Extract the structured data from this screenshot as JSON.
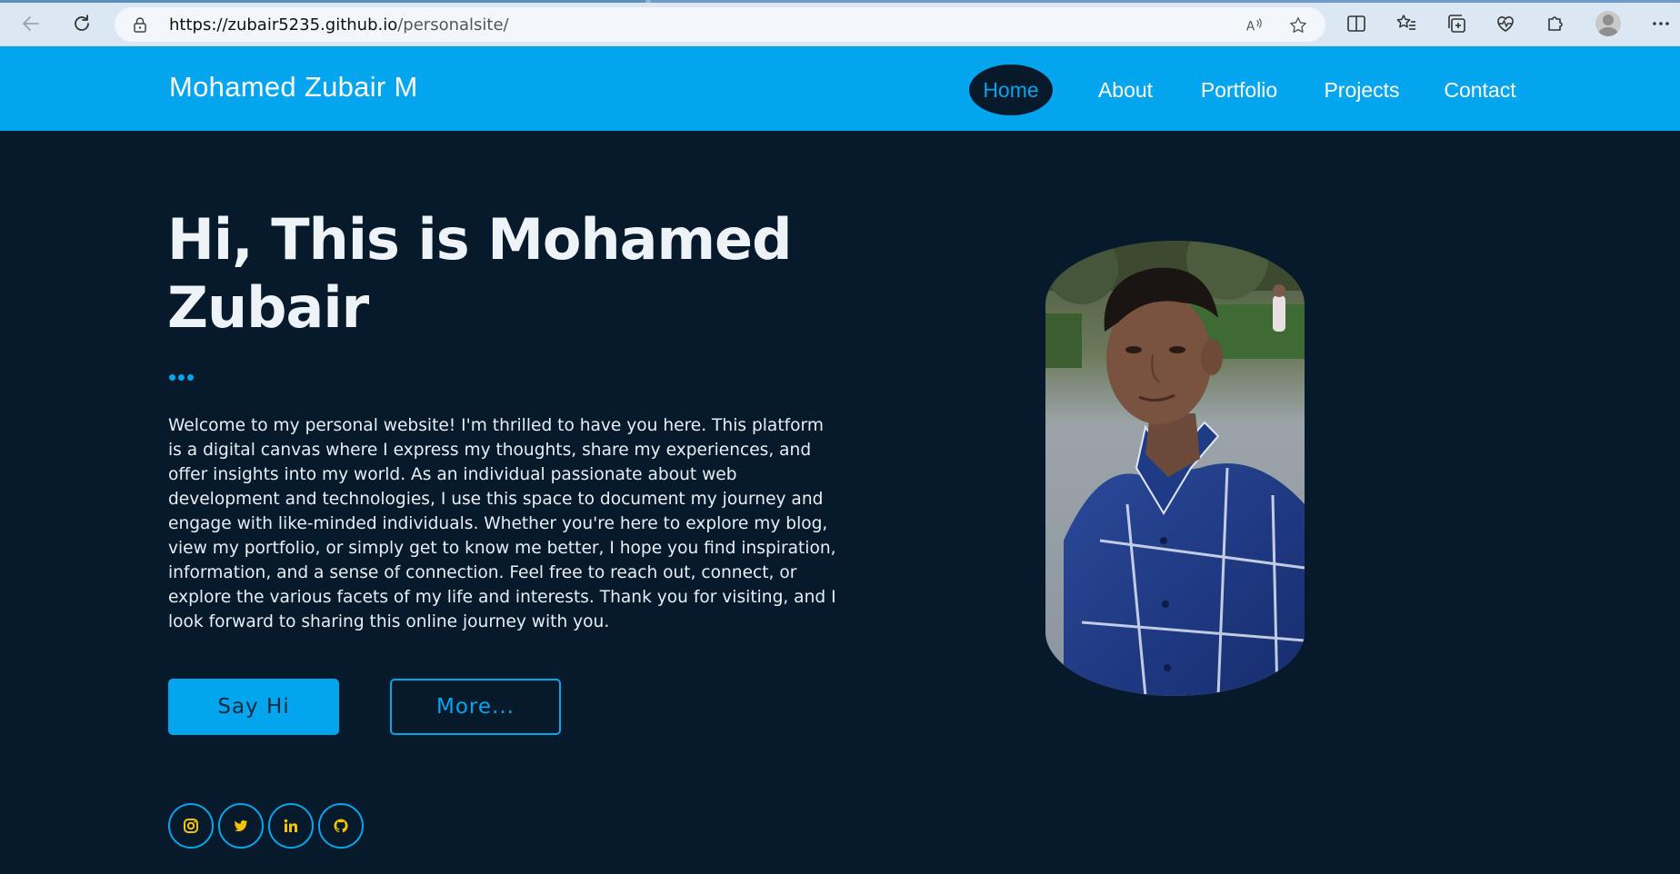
{
  "browser": {
    "url_host": "https://zubair5235.github.io",
    "url_path": "/personalsite/",
    "icons": [
      "back-icon",
      "refresh-icon",
      "lock-icon",
      "read-aloud-icon",
      "favorite-star-icon",
      "split-screen-icon",
      "favorites-icon",
      "collections-icon",
      "health-icon",
      "extensions-icon",
      "profile-icon",
      "more-icon"
    ]
  },
  "header": {
    "brand": "Mohamed Zubair M",
    "nav": [
      "Home",
      "About",
      "Portfolio",
      "Projects",
      "Contact"
    ],
    "active": "Home"
  },
  "hero": {
    "title_line1": "Hi, This is Mohamed",
    "title_line2": "Zubair",
    "intro": "Welcome to my personal website! I'm thrilled to have you here. This platform is a digital canvas where I express my thoughts, share my experiences, and offer insights into my world. As an individual passionate about web development and technologies, I use this space to document my journey and engage with like-minded individuals. Whether you're here to explore my blog, view my portfolio, or simply get to know me better, I hope you find inspiration, information, and a sense of connection. Feel free to reach out, connect, or explore the various facets of my life and interests. Thank you for visiting, and I look forward to sharing this online journey with you.",
    "primary_button": "Say Hi",
    "secondary_button": "More...",
    "socials": [
      "instagram-icon",
      "twitter-icon",
      "linkedin-icon",
      "github-icon"
    ]
  },
  "colors": {
    "accent": "#03a5ef",
    "background": "#061a2b",
    "social_icon": "#f5c400",
    "text": "#e8eef4"
  }
}
